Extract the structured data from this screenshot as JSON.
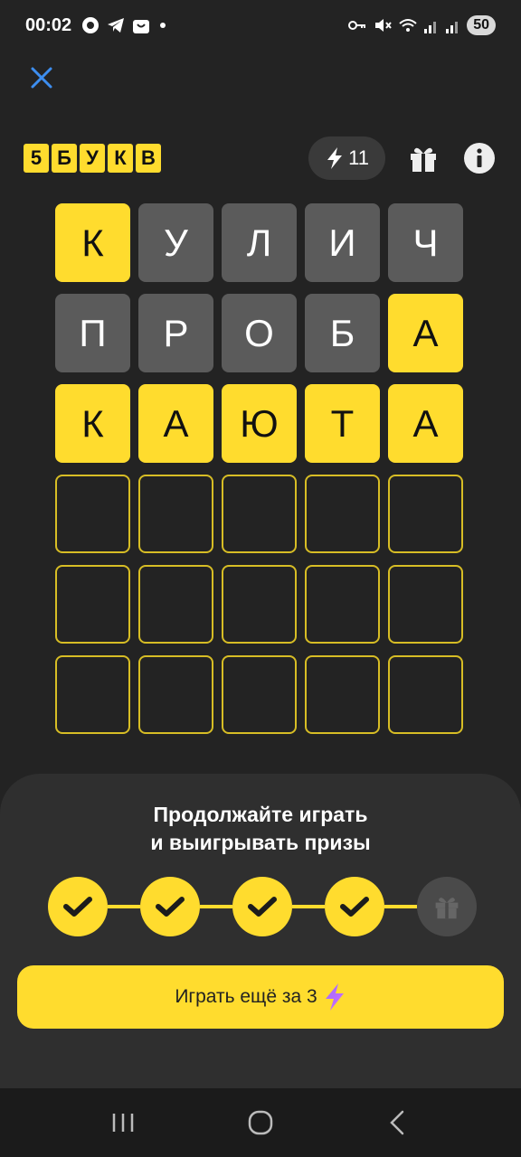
{
  "status_bar": {
    "time": "00:02",
    "battery": "50",
    "left_icons": [
      "settings-icon",
      "telegram-icon",
      "shopping-bag-icon",
      "dot-icon"
    ],
    "right_icons": [
      "key-icon",
      "mute-icon",
      "wifi-icon",
      "signal-icon",
      "signal-icon"
    ]
  },
  "header": {
    "logo_letters": [
      "5",
      "Б",
      "У",
      "К",
      "В"
    ],
    "energy_count": "11"
  },
  "board": {
    "rows": [
      [
        {
          "letter": "К",
          "state": "yellow"
        },
        {
          "letter": "У",
          "state": "gray"
        },
        {
          "letter": "Л",
          "state": "gray"
        },
        {
          "letter": "И",
          "state": "gray"
        },
        {
          "letter": "Ч",
          "state": "gray"
        }
      ],
      [
        {
          "letter": "П",
          "state": "gray"
        },
        {
          "letter": "Р",
          "state": "gray"
        },
        {
          "letter": "О",
          "state": "gray"
        },
        {
          "letter": "Б",
          "state": "gray"
        },
        {
          "letter": "А",
          "state": "yellow"
        }
      ],
      [
        {
          "letter": "К",
          "state": "yellow"
        },
        {
          "letter": "А",
          "state": "yellow"
        },
        {
          "letter": "Ю",
          "state": "yellow"
        },
        {
          "letter": "Т",
          "state": "yellow"
        },
        {
          "letter": "А",
          "state": "yellow"
        }
      ],
      [
        {
          "letter": "",
          "state": "empty"
        },
        {
          "letter": "",
          "state": "empty"
        },
        {
          "letter": "",
          "state": "empty"
        },
        {
          "letter": "",
          "state": "empty"
        },
        {
          "letter": "",
          "state": "empty"
        }
      ],
      [
        {
          "letter": "",
          "state": "empty"
        },
        {
          "letter": "",
          "state": "empty"
        },
        {
          "letter": "",
          "state": "empty"
        },
        {
          "letter": "",
          "state": "empty"
        },
        {
          "letter": "",
          "state": "empty"
        }
      ],
      [
        {
          "letter": "",
          "state": "empty"
        },
        {
          "letter": "",
          "state": "empty"
        },
        {
          "letter": "",
          "state": "empty"
        },
        {
          "letter": "",
          "state": "empty"
        },
        {
          "letter": "",
          "state": "empty"
        }
      ]
    ]
  },
  "sheet": {
    "title_line1": "Продолжайте играть",
    "title_line2": "и выигрывать призы",
    "progress": [
      "done",
      "done",
      "done",
      "done",
      "gift"
    ],
    "play_button_label": "Играть ещё за 3"
  },
  "colors": {
    "accent": "#ffdc2e",
    "background": "#232323",
    "tile_gray": "#5b5b5b",
    "sheet": "#2f2f2f"
  }
}
